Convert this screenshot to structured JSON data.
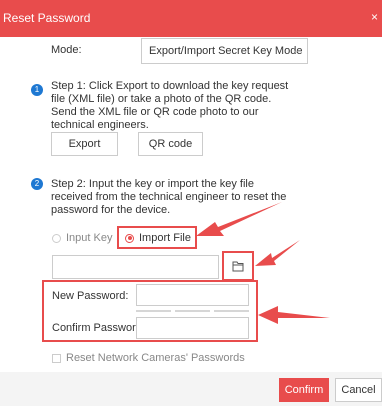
{
  "dialog": {
    "title": "Reset Password"
  },
  "mode": {
    "label": "Mode:",
    "value": "Export/Import Secret Key Mode"
  },
  "step1": {
    "number": "1",
    "text": "Step 1: Click Export to download the key request file (XML file) or take a photo of the QR code. Send the XML file or QR code photo to our technical engineers.",
    "export_label": "Export",
    "qr_label": "QR code"
  },
  "step2": {
    "number": "2",
    "text": "Step 2: Input the key or import the key file received from the technical engineer to reset the password for the device.",
    "input_key_label": "Input Key",
    "import_file_label": "Import File",
    "selected": "Import File"
  },
  "file": {
    "value": ""
  },
  "password": {
    "new_label": "New Password:",
    "new_value": "",
    "confirm_label": "Confirm Password:",
    "confirm_value": ""
  },
  "reset_cameras": {
    "label": "Reset Network Cameras' Passwords",
    "checked": false
  },
  "footer": {
    "confirm_label": "Confirm",
    "cancel_label": "Cancel"
  },
  "colors": {
    "accent": "#e84c4c",
    "step_badge": "#1e78d2"
  }
}
